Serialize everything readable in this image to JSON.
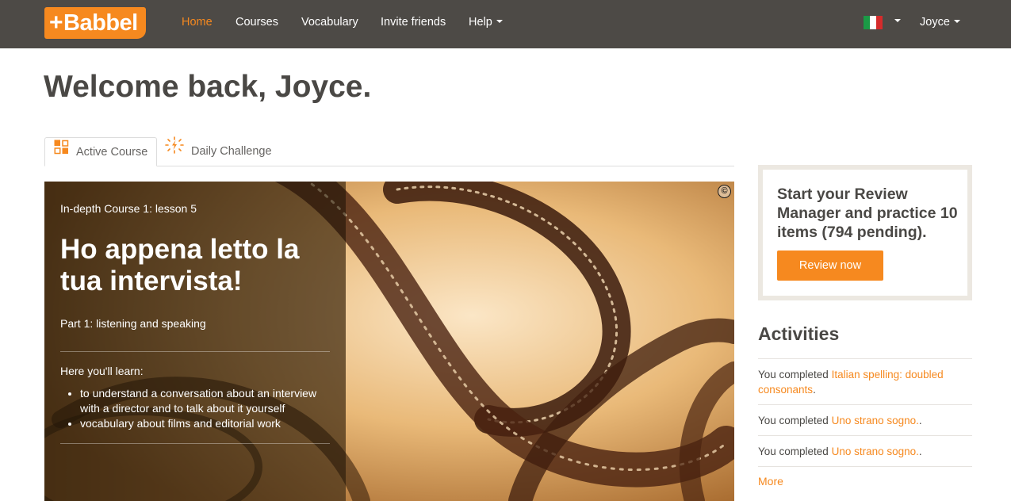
{
  "brand": {
    "logo_text": "Babbel",
    "logo_plus": "+",
    "accent_color": "#f6891f",
    "nav_background": "#4d4a46"
  },
  "nav": {
    "items": [
      {
        "label": "Home",
        "active": true
      },
      {
        "label": "Courses",
        "active": false
      },
      {
        "label": "Vocabulary",
        "active": false
      },
      {
        "label": "Invite friends",
        "active": false
      },
      {
        "label": "Help",
        "active": false,
        "dropdown": true
      }
    ],
    "language_flag": "italy-flag",
    "user_menu_label": "Joyce"
  },
  "page": {
    "welcome": "Welcome back, Joyce."
  },
  "tabs": [
    {
      "label": "Active Course",
      "icon": "grid-squares-icon",
      "active": true
    },
    {
      "label": "Daily Challenge",
      "icon": "lightning-burst-icon",
      "active": false
    }
  ],
  "course": {
    "lesson_label": "In-depth Course 1: lesson 5",
    "title": "Ho appena letto la tua intervista!",
    "part_label": "Part 1: listening and speaking",
    "learn_heading": "Here you'll learn:",
    "learn_items": [
      "to understand a conversation about an interview with a director and to talk about it yourself",
      "vocabulary about films and editorial work"
    ],
    "image_icon": "copyright-icon",
    "copyright_symbol": "©"
  },
  "review": {
    "text": "Start your Review Manager and practice 10 items (794 pending).",
    "button_label": "Review now"
  },
  "activities": {
    "title": "Activities",
    "items": [
      {
        "prefix": "You completed ",
        "link": "Italian spelling: doubled consonants",
        "suffix": "."
      },
      {
        "prefix": "You completed ",
        "link": "Uno strano sogno.",
        "suffix": "."
      },
      {
        "prefix": "You completed ",
        "link": "Uno strano sogno.",
        "suffix": "."
      }
    ],
    "more_label": "More"
  }
}
